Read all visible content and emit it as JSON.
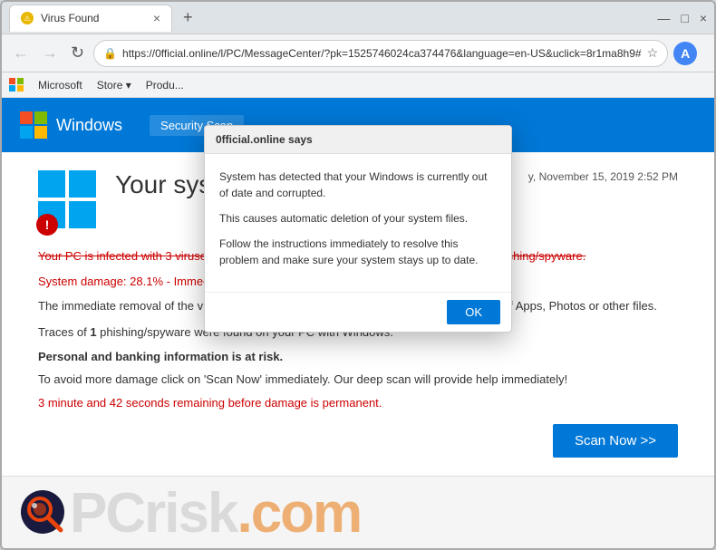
{
  "browser": {
    "tab": {
      "favicon_color": "#e8b800",
      "title": "Virus Found",
      "close_icon": "×",
      "new_tab_icon": "+"
    },
    "controls": {
      "minimize": "—",
      "maximize": "□",
      "close": "×"
    },
    "nav": {
      "back": "←",
      "forward": "→",
      "reload": "↻"
    },
    "url": "https://0fficial.online/l/PC/MessageCenter/?pk=1525746024ca374476&language=en-US&uclick=8r1ma8h9#",
    "star_icon": "☆",
    "profile_letter": "A",
    "menu_dots": "⋮"
  },
  "menubar": {
    "brand": "Microsoft",
    "items": [
      "Store ▾",
      "Produ..."
    ]
  },
  "win_header": {
    "logo_text": "Windows",
    "security_scan": "Security Scan"
  },
  "page": {
    "title": "Your sys...",
    "date": "y, November 15, 2019 2:52 PM",
    "alert_line1": "Your PC is infected with 3 viruses. Our security check found traces of 2 malware and  1 phishing/spyware.",
    "alert_line2": "System damage: 28.1% - Immediate removal required!",
    "body_para1": "The immediate removal of the viruses is required to prevent further system damage, loss of Apps, Photos or other files.",
    "body_para2": "Traces of 1 phishing/spyware were found on your PC with Windows.",
    "bold_risk": "Personal and banking information is at risk.",
    "body_para3": "To avoid more damage click on 'Scan Now' immediately. Our deep scan will provide help immediately!",
    "timer": "3 minute and 42 seconds remaining before damage is permanent.",
    "scan_btn": "Scan Now >>"
  },
  "dialog": {
    "title": "0fficial.online says",
    "line1": "System has detected that your Windows is currently out of date and corrupted.",
    "line2": "This causes automatic deletion of your system files.",
    "line3": "Follow the instructions immediately to resolve this problem and make sure your system stays up to date.",
    "ok_btn": "OK"
  },
  "footer": {
    "pc": "PC",
    "risk": "risk",
    "com": ".com"
  }
}
